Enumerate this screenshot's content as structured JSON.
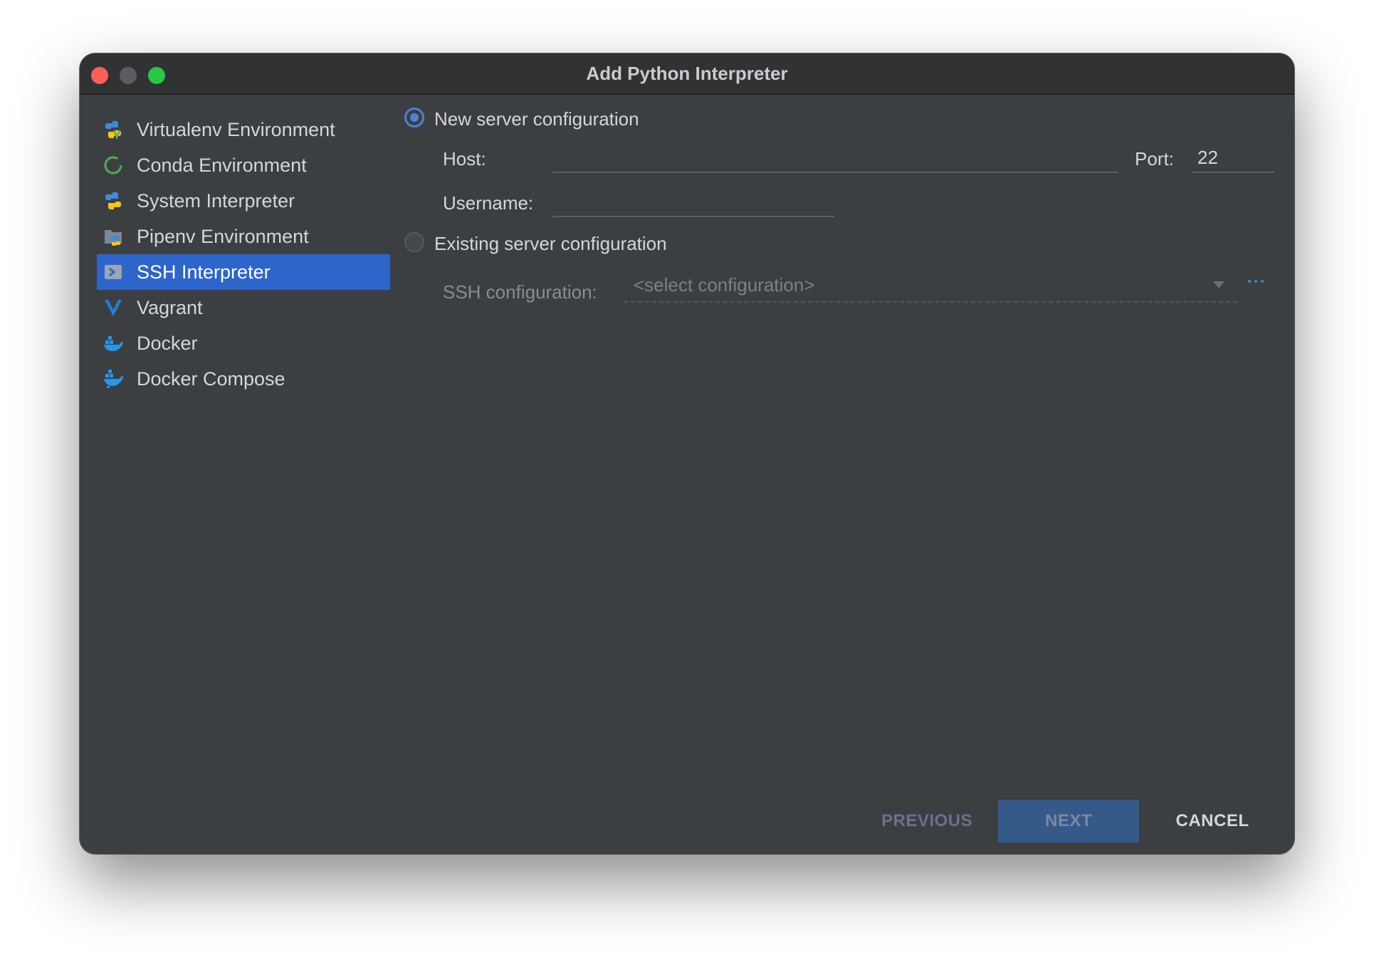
{
  "window": {
    "title": "Add Python Interpreter"
  },
  "sidebar": {
    "items": [
      {
        "label": "Virtualenv Environment",
        "icon": "python-virtualenv-icon"
      },
      {
        "label": "Conda Environment",
        "icon": "conda-icon"
      },
      {
        "label": "System Interpreter",
        "icon": "python-icon"
      },
      {
        "label": "Pipenv Environment",
        "icon": "pipenv-icon"
      },
      {
        "label": "SSH Interpreter",
        "icon": "ssh-terminal-icon",
        "selected": true
      },
      {
        "label": "Vagrant",
        "icon": "vagrant-icon"
      },
      {
        "label": "Docker",
        "icon": "docker-icon"
      },
      {
        "label": "Docker Compose",
        "icon": "docker-compose-icon"
      }
    ]
  },
  "form": {
    "new_server": {
      "label": "New server configuration",
      "checked": true
    },
    "host": {
      "label": "Host:",
      "value": ""
    },
    "port": {
      "label": "Port:",
      "value": "22"
    },
    "username": {
      "label": "Username:",
      "value": ""
    },
    "existing_server": {
      "label": "Existing server configuration",
      "checked": false
    },
    "ssh_config": {
      "label": "SSH configuration:",
      "placeholder": "<select configuration>"
    }
  },
  "buttons": {
    "previous": "PREVIOUS",
    "next": "NEXT",
    "cancel": "CANCEL"
  },
  "colors": {
    "accent": "#2e65ca",
    "background": "#3c3f42",
    "titlebar": "#303234"
  }
}
